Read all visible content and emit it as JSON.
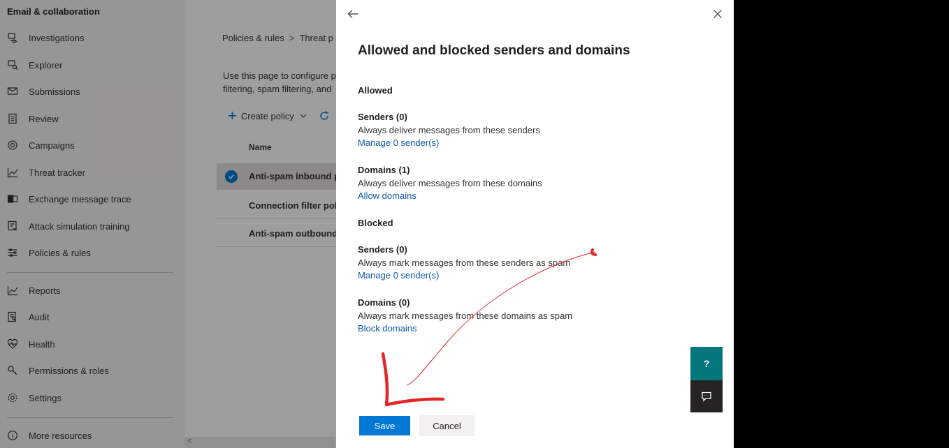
{
  "nav": {
    "section": "Email & collaboration",
    "items": [
      {
        "label": "Investigations",
        "icon": "investigations-icon"
      },
      {
        "label": "Explorer",
        "icon": "explorer-icon"
      },
      {
        "label": "Submissions",
        "icon": "submissions-icon"
      },
      {
        "label": "Review",
        "icon": "review-icon"
      },
      {
        "label": "Campaigns",
        "icon": "campaigns-icon"
      },
      {
        "label": "Threat tracker",
        "icon": "threat-tracker-icon"
      },
      {
        "label": "Exchange message trace",
        "icon": "exchange-icon"
      },
      {
        "label": "Attack simulation training",
        "icon": "attack-simulation-icon"
      },
      {
        "label": "Policies & rules",
        "icon": "policies-icon"
      },
      {
        "label": "Reports",
        "icon": "reports-icon"
      },
      {
        "label": "Audit",
        "icon": "audit-icon"
      },
      {
        "label": "Health",
        "icon": "health-icon"
      },
      {
        "label": "Permissions & roles",
        "icon": "permissions-icon"
      },
      {
        "label": "Settings",
        "icon": "settings-icon"
      },
      {
        "label": "More resources",
        "icon": "info-icon"
      }
    ]
  },
  "main": {
    "breadcrumb": {
      "first": "Policies & rules",
      "second": "Threat p"
    },
    "desc_line1": "Use this page to configure p",
    "desc_line2": "filtering, spam filtering, and",
    "create_policy": "Create policy",
    "column_name": "Name",
    "rows": [
      "Anti-spam inbound p",
      "Connection filter pol",
      "Anti-spam outbound"
    ]
  },
  "panel": {
    "title": "Allowed and blocked senders and domains",
    "allowed": {
      "heading": "Allowed",
      "senders": {
        "title": "Senders (0)",
        "desc": "Always deliver messages from these senders",
        "link": "Manage 0 sender(s)"
      },
      "domains": {
        "title": "Domains (1)",
        "desc": "Always deliver messages from these domains",
        "link": "Allow domains"
      }
    },
    "blocked": {
      "heading": "Blocked",
      "senders": {
        "title": "Senders (0)",
        "desc": "Always mark messages from these senders as spam",
        "link": "Manage 0 sender(s)"
      },
      "domains": {
        "title": "Domains (0)",
        "desc": "Always mark messages from these domains as spam",
        "link": "Block domains"
      }
    },
    "save": "Save",
    "cancel": "Cancel"
  },
  "colors": {
    "accent": "#0078d4",
    "link": "#0f5aa8",
    "help": "#03787c",
    "annotation": "#e3262a"
  }
}
